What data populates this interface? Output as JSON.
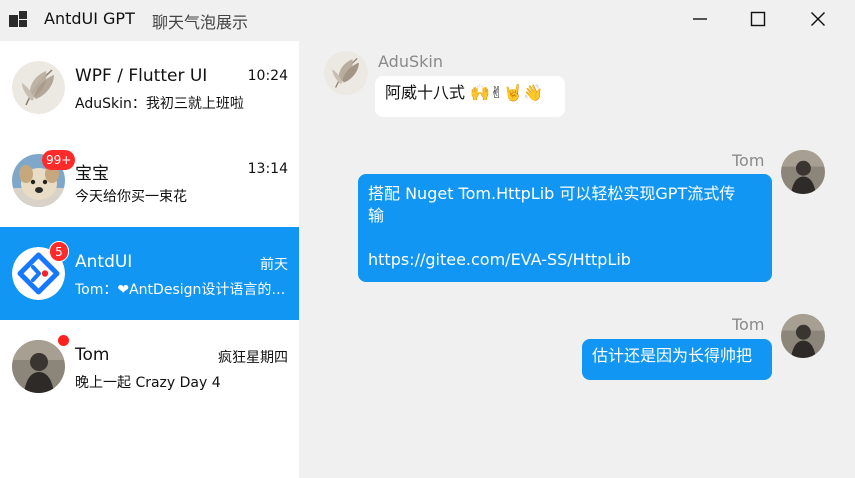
{
  "window": {
    "title": "AntdUI GPT",
    "subtitle": "聊天气泡展示",
    "accent_color": "#1296f3",
    "controls": [
      "minimize-icon",
      "maximize-icon",
      "close-icon"
    ]
  },
  "conversations": [
    {
      "name": "WPF / Flutter UI",
      "time": "10:24",
      "preview": "AduSkin：我初三就上班啦",
      "avatar": "feather-avatar"
    },
    {
      "name": "宝宝",
      "time": "13:14",
      "preview": "今天给你买一束花",
      "avatar": "dog-avatar",
      "badge": "99+"
    },
    {
      "name": "AntdUI",
      "time": "前天",
      "preview": "Tom：❤AntDesign设计语言的Winform界面库",
      "avatar": "antdui-logo-avatar",
      "badge": "5",
      "active": true
    },
    {
      "name": "Tom",
      "time": "疯狂星期四",
      "preview": "晚上一起 Crazy Day 4",
      "avatar": "person-avatar",
      "dot": true
    }
  ],
  "messages": [
    {
      "sender": "AduSkin",
      "direction": "in",
      "text": "阿威十八式 🙌✌🤘👋"
    },
    {
      "sender": "Tom",
      "direction": "out",
      "lines": [
        "搭配 Nuget Tom.HttpLib 可以轻松实现GPT流式传",
        "输",
        "",
        "https://gitee.com/EVA-SS/HttpLib"
      ]
    },
    {
      "sender": "Tom",
      "direction": "out",
      "text": "估计还是因为长得帅把"
    }
  ]
}
